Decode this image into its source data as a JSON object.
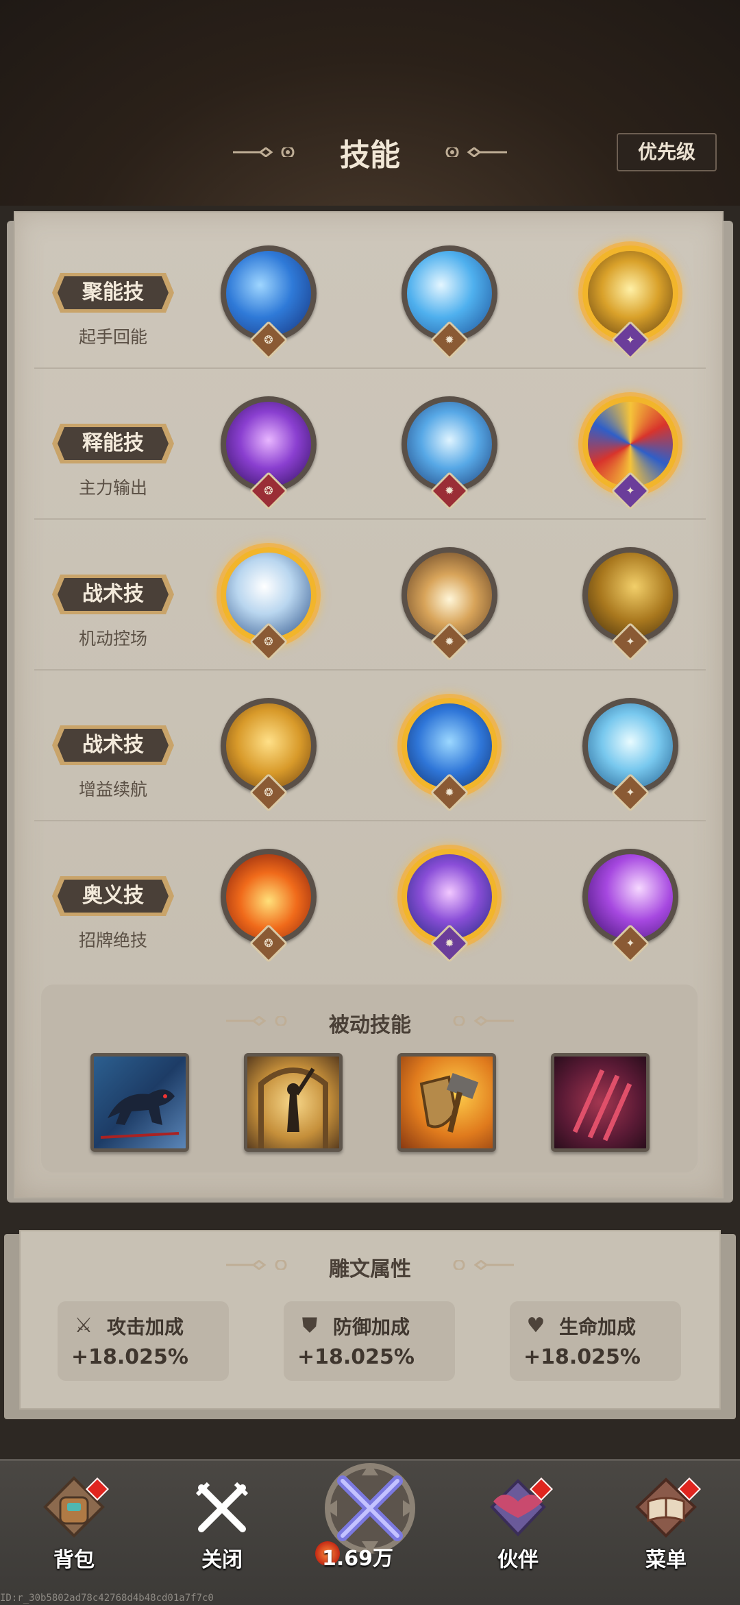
{
  "header": {
    "title": "技能",
    "priority_button": "优先级"
  },
  "skill_rows": [
    {
      "category": "聚能技",
      "subtitle": "起手回能",
      "skills": [
        {
          "icon": "blue-wind-slash-icon",
          "badge": "brown",
          "highlighted": false
        },
        {
          "icon": "ice-wave-icon",
          "badge": "brown",
          "highlighted": false
        },
        {
          "icon": "golden-lightning-icon",
          "badge": "purple",
          "highlighted": true
        }
      ]
    },
    {
      "category": "释能技",
      "subtitle": "主力输出",
      "skills": [
        {
          "icon": "purple-sword-icon",
          "badge": "red",
          "highlighted": false
        },
        {
          "icon": "ice-shards-icon",
          "badge": "red",
          "highlighted": false
        },
        {
          "icon": "tri-color-vortex-icon",
          "badge": "purple",
          "highlighted": true
        }
      ]
    },
    {
      "category": "战术技",
      "subtitle": "机动控场",
      "skills": [
        {
          "icon": "frost-crescent-icon",
          "badge": "brown",
          "highlighted": true
        },
        {
          "icon": "light-burst-icon",
          "badge": "brown",
          "highlighted": false
        },
        {
          "icon": "golden-dash-icon",
          "badge": "brown",
          "highlighted": false
        }
      ]
    },
    {
      "category": "战术技",
      "subtitle": "增益续航",
      "skills": [
        {
          "icon": "golden-tiger-icon",
          "badge": "brown",
          "highlighted": false
        },
        {
          "icon": "blue-tiger-icon",
          "badge": "brown",
          "highlighted": true
        },
        {
          "icon": "spirit-shield-icon",
          "badge": "brown",
          "highlighted": false
        }
      ]
    },
    {
      "category": "奥义技",
      "subtitle": "招牌绝技",
      "skills": [
        {
          "icon": "fire-warrior-icon",
          "badge": "brown",
          "highlighted": false
        },
        {
          "icon": "arcane-spirit-icon",
          "badge": "purple",
          "highlighted": true
        },
        {
          "icon": "violet-blast-icon",
          "badge": "brown",
          "highlighted": false
        }
      ]
    }
  ],
  "passive": {
    "title": "被动技能",
    "skills": [
      "wolf-charge-icon",
      "sword-hero-icon",
      "hammer-shield-icon",
      "claw-slash-icon"
    ]
  },
  "runes": {
    "title": "雕文属性",
    "stats": [
      {
        "icon": "attack-icon",
        "label": "攻击加成",
        "value": "+18.025%"
      },
      {
        "icon": "defense-icon",
        "label": "防御加成",
        "value": "+18.025%"
      },
      {
        "icon": "health-icon",
        "label": "生命加成",
        "value": "+18.025%"
      }
    ]
  },
  "nav": {
    "bag": "背包",
    "close": "关闭",
    "power": "1.69万",
    "partner": "伙伴",
    "menu": "菜单"
  },
  "footer_id": "ID:r_30b5802ad78c42768d4b48cd01a7f7c0"
}
